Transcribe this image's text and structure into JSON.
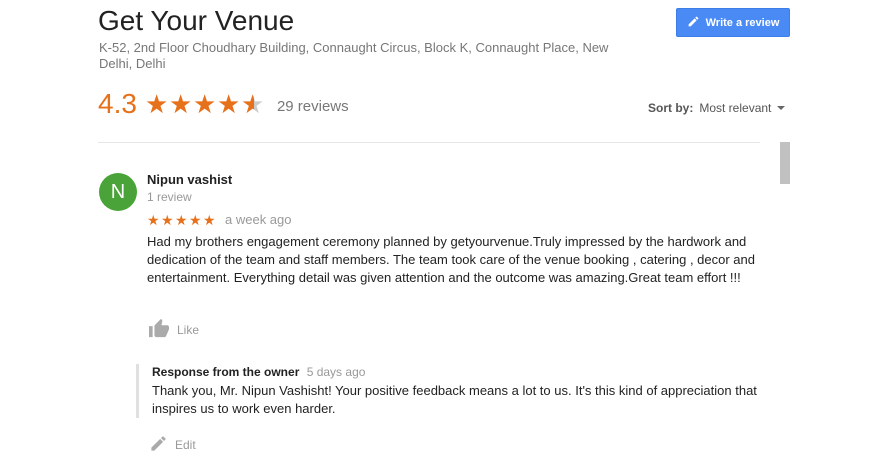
{
  "venue": {
    "title": "Get Your Venue",
    "address": "K-52, 2nd Floor Choudhary Building, Connaught Circus, Block K, Connaught Place, New Delhi, Delhi"
  },
  "write_review": {
    "label": "Write a review",
    "icon": "pencil-icon"
  },
  "rating": {
    "value": "4.3",
    "stars": 4.3,
    "count_label": "29 reviews"
  },
  "sort": {
    "label": "Sort by:",
    "value": "Most relevant"
  },
  "colors": {
    "accent": "#e7711b",
    "button": "#4a8af4",
    "avatar": "#4aa339"
  },
  "review": {
    "initial": "N",
    "name": "Nipun vashist",
    "review_count": "1 review",
    "stars": 5,
    "time": "a week ago",
    "text": "Had my brothers engagement ceremony planned by getyourvenue.Truly impressed by the hardwork and dedication of the team and staff members. The team took care of the venue booking , catering , decor and entertainment. Everything detail was given attention and the outcome was amazing.Great team effort !!!",
    "like_label": "Like"
  },
  "response": {
    "heading": "Response from the owner",
    "time": "5 days ago",
    "text": "Thank you, Mr. Nipun Vashisht! Your positive feedback means a lot to us. It's this kind of appreciation that inspires us to work even harder.",
    "edit_label": "Edit"
  }
}
